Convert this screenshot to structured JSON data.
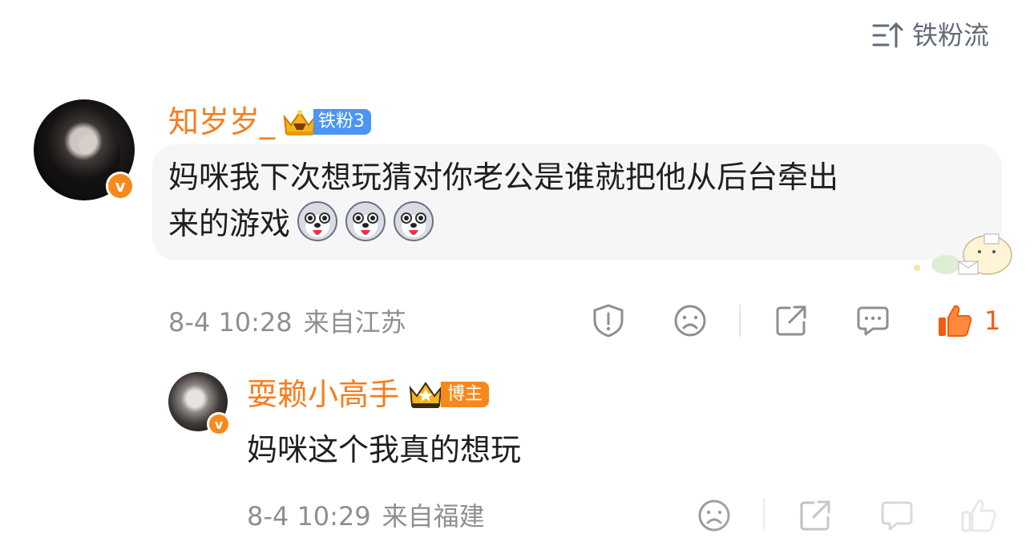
{
  "sort": {
    "label": "铁粉流",
    "icon": "sort-icon"
  },
  "comment": {
    "username": "知岁岁_",
    "fan_badge": "铁粉3",
    "verified_mark": "v",
    "text_line1": "妈咪我下次想玩猜对你老公是谁就把他从后台牵出",
    "text_line2": "来的游戏",
    "emojis": [
      "husky-emoji",
      "husky-emoji",
      "husky-emoji"
    ],
    "time": "8-4 10:28",
    "location": "来自江苏",
    "like_count": "1"
  },
  "reply": {
    "username": "耍赖小高手",
    "role_badge": "博主",
    "verified_mark": "v",
    "text": "妈咪这个我真的想玩",
    "time": "8-4 10:29",
    "location": "来自福建"
  },
  "colors": {
    "username": "#f77d1c",
    "fan_badge": "#4d95f2",
    "host_badge": "#f7891c",
    "like": "#f35c0f",
    "meta": "#8e8f94",
    "bubble": "#f6f6f7"
  }
}
